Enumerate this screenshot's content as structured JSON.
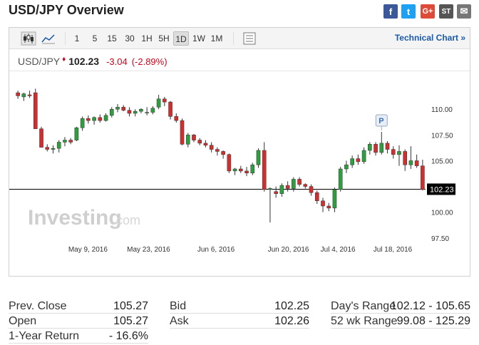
{
  "page": {
    "title": "USD/JPY Overview"
  },
  "share": {
    "facebook": "f",
    "twitter": "t",
    "google": "G+",
    "stocktwits": "ST",
    "mail": "✉"
  },
  "toolbar": {
    "intervals": [
      "1",
      "5",
      "15",
      "30",
      "1H",
      "5H",
      "1D",
      "1W",
      "1M"
    ],
    "active_interval": "1D",
    "technical_link": "Technical Chart »"
  },
  "quote": {
    "symbol": "USD/JPY",
    "price": "102.23",
    "change": "-3.04",
    "change_pct": "(-2.89%)"
  },
  "watermark": {
    "brand": "Investing",
    "suffix": ".com"
  },
  "chart_data": {
    "type": "candlestick",
    "y_ticks": [
      "110.00",
      "107.50",
      "105.00",
      "102.50",
      "100.00",
      "97.50"
    ],
    "y_tick_values": [
      110.0,
      107.5,
      105.0,
      102.5,
      100.0,
      97.5
    ],
    "ylim": [
      97.0,
      113.2
    ],
    "x_ticks": [
      "May 9, 2016",
      "May 23, 2016",
      "Jun 6, 2016",
      "Jun 20, 2016",
      "Jul 4, 2016",
      "Jul 18, 2016"
    ],
    "last_price_label": "102.23",
    "last_price": 102.23,
    "annotation": "P",
    "up_color": "#2e9e3e",
    "down_color": "#d12f2f",
    "candles": [
      [
        111.6,
        111.8,
        111.0,
        111.3
      ],
      [
        111.2,
        111.6,
        110.8,
        111.5
      ],
      [
        111.4,
        111.8,
        111.1,
        111.3
      ],
      [
        111.6,
        112.0,
        108.8,
        108.1
      ],
      [
        108.1,
        108.3,
        106.3,
        106.3
      ],
      [
        106.3,
        106.6,
        105.9,
        106.1
      ],
      [
        106.1,
        106.5,
        105.7,
        106.2
      ],
      [
        106.2,
        107.0,
        105.8,
        106.8
      ],
      [
        106.8,
        107.3,
        106.4,
        107.0
      ],
      [
        107.0,
        107.2,
        106.6,
        106.8
      ],
      [
        107.0,
        108.3,
        106.9,
        108.2
      ],
      [
        108.2,
        109.3,
        107.9,
        109.1
      ],
      [
        109.1,
        109.4,
        108.6,
        108.9
      ],
      [
        108.9,
        109.3,
        108.5,
        109.2
      ],
      [
        109.2,
        109.5,
        108.7,
        108.9
      ],
      [
        108.9,
        109.6,
        108.8,
        109.4
      ],
      [
        109.4,
        110.2,
        109.2,
        110.0
      ],
      [
        110.0,
        110.5,
        109.7,
        110.2
      ],
      [
        110.2,
        110.4,
        109.8,
        109.9
      ],
      [
        109.9,
        110.2,
        109.3,
        109.6
      ],
      [
        109.6,
        110.0,
        109.3,
        109.8
      ],
      [
        109.8,
        110.1,
        109.6,
        110.0
      ],
      [
        109.7,
        110.2,
        109.4,
        109.7
      ],
      [
        109.7,
        110.3,
        109.5,
        110.1
      ],
      [
        110.2,
        111.4,
        110.0,
        111.0
      ],
      [
        111.0,
        111.2,
        110.3,
        110.7
      ],
      [
        110.7,
        110.8,
        109.0,
        109.3
      ],
      [
        109.3,
        109.6,
        108.7,
        108.9
      ],
      [
        108.9,
        109.1,
        106.5,
        106.6
      ],
      [
        106.6,
        107.7,
        106.3,
        107.5
      ],
      [
        107.5,
        107.6,
        106.8,
        107.0
      ],
      [
        107.0,
        107.2,
        106.5,
        106.7
      ],
      [
        106.7,
        107.0,
        106.3,
        106.5
      ],
      [
        106.5,
        106.8,
        105.8,
        106.1
      ],
      [
        106.1,
        106.3,
        105.5,
        105.9
      ],
      [
        105.9,
        106.0,
        105.2,
        105.6
      ],
      [
        105.6,
        105.7,
        103.8,
        104.0
      ],
      [
        104.0,
        104.3,
        103.6,
        104.2
      ],
      [
        104.2,
        104.5,
        103.8,
        104.0
      ],
      [
        104.0,
        104.4,
        103.5,
        103.8
      ],
      [
        103.8,
        104.8,
        103.6,
        104.6
      ],
      [
        104.6,
        106.2,
        104.3,
        106.0
      ],
      [
        106.0,
        106.8,
        102.0,
        102.2
      ],
      [
        102.2,
        102.4,
        99.0,
        102.3
      ],
      [
        102.0,
        102.5,
        101.4,
        101.8
      ],
      [
        101.8,
        102.8,
        101.5,
        102.6
      ],
      [
        102.6,
        103.0,
        102.0,
        102.3
      ],
      [
        102.3,
        103.4,
        102.0,
        103.2
      ],
      [
        103.2,
        103.4,
        102.5,
        102.7
      ],
      [
        102.7,
        102.8,
        102.3,
        102.5
      ],
      [
        102.5,
        102.7,
        101.6,
        101.9
      ],
      [
        101.9,
        102.1,
        100.8,
        101.1
      ],
      [
        101.1,
        101.4,
        100.0,
        100.6
      ],
      [
        100.6,
        100.9,
        100.1,
        100.4
      ],
      [
        100.4,
        102.4,
        100.0,
        102.2
      ],
      [
        102.2,
        104.4,
        102.0,
        104.2
      ],
      [
        104.2,
        105.0,
        103.8,
        104.6
      ],
      [
        104.6,
        105.5,
        104.3,
        105.2
      ],
      [
        105.2,
        105.6,
        104.6,
        104.9
      ],
      [
        104.9,
        106.3,
        104.7,
        106.0
      ],
      [
        106.0,
        106.8,
        105.6,
        106.6
      ],
      [
        106.6,
        106.8,
        105.5,
        105.8
      ],
      [
        105.8,
        107.8,
        105.6,
        106.7
      ],
      [
        106.7,
        106.9,
        105.7,
        106.1
      ],
      [
        106.1,
        106.4,
        105.2,
        105.6
      ],
      [
        105.6,
        106.5,
        104.5,
        105.9
      ],
      [
        105.9,
        106.1,
        104.0,
        104.6
      ],
      [
        104.6,
        106.4,
        104.2,
        105.0
      ],
      [
        105.0,
        105.6,
        104.3,
        104.5
      ],
      [
        104.5,
        105.1,
        102.1,
        102.2
      ]
    ]
  },
  "stats": [
    {
      "label": "Prev. Close",
      "value": "105.27"
    },
    {
      "label": "Open",
      "value": "105.27"
    },
    {
      "label": "1-Year Return",
      "value": "- 16.6%"
    },
    {
      "label": "Bid",
      "value": "102.25"
    },
    {
      "label": "Ask",
      "value": "102.26"
    },
    {
      "label": "Day's Range",
      "value": "102.12 - 105.65"
    },
    {
      "label": "52 wk Range",
      "value": "99.08 - 125.29"
    }
  ]
}
